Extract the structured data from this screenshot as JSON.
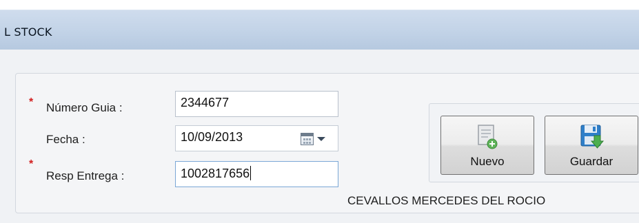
{
  "window": {
    "title": "L STOCK"
  },
  "form": {
    "numero_guia": {
      "label": "Número Guia :",
      "value": "2344677",
      "required": true
    },
    "fecha": {
      "label": "Fecha :",
      "value": "10/09/2013"
    },
    "resp_entrega": {
      "label": "Resp Entrega :",
      "value": "1002817656",
      "required": true
    },
    "required_mark": "*",
    "resp_entrega_name": "CEVALLOS MERCEDES DEL ROCIO"
  },
  "toolbar": {
    "nuevo_label": "Nuevo",
    "guardar_label": "Guardar",
    "nuevo_icon": "new-document-icon",
    "guardar_icon": "save-floppy-icon"
  },
  "colors": {
    "required": "#d21f1f",
    "titlebar": "#c2d3e7"
  }
}
